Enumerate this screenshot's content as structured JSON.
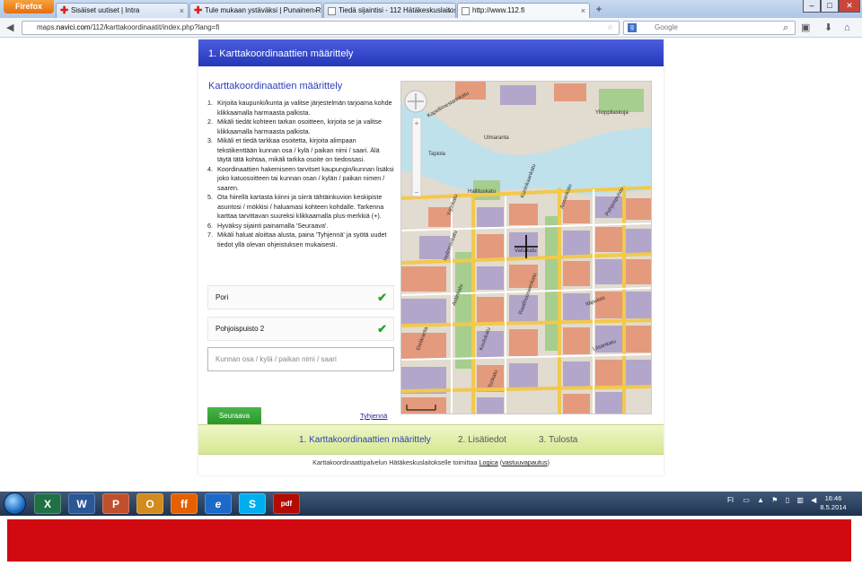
{
  "browser": {
    "menu_button": "Firefox",
    "tabs": [
      {
        "label": "Sisäiset uutiset | Intra",
        "icon": "red-cross-icon"
      },
      {
        "label": "Tule mukaan ystäväksi | Punainen Risti",
        "icon": "red-cross-icon"
      },
      {
        "label": "Tiedä sijaintisi - 112 Hätäkeskuslaitos",
        "icon": "page-icon"
      },
      {
        "label": "http://www.112.fi",
        "icon": "page-icon"
      }
    ],
    "new_tab": "+",
    "url_prefix": "maps.",
    "url_domain": "navici.com",
    "url_path": "/112/karttakoordinaatit/index.php?lang=fi",
    "search_placeholder": "Google",
    "window_buttons": [
      "–",
      "□",
      "✕"
    ]
  },
  "page": {
    "header": "1. Karttakoordinaattien määrittely",
    "heading": "Karttakoordinaattien määrittely",
    "steps": [
      {
        "num": "1.",
        "text": "Kirjoita kaupunki/kunta ja valitse järjestelmän tarjoama kohde klikkaamalla harmaasta palkista."
      },
      {
        "num": "2.",
        "text": "Mikäli tiedät kohteen tarkan osoitteen, kirjoita se ja valitse klikkaamalla harmaasta palkista."
      },
      {
        "num": "3.",
        "text": "Mikäli et tiedä tarkkaa osoitetta, kirjoita alimpaan tekstikenttään kunnan osa / kylä / paikan nimi / saari. Älä täytä tätä kohtaa, mikäli tarkka osoite on tiedossasi."
      },
      {
        "num": "4.",
        "text": "Koordinaattien hakemiseen tarvitset kaupungin/kunnan lisäksi joko katuosoitteen tai kunnan osan / kylän / paikan nimen / saaren."
      },
      {
        "num": "5.",
        "text": "Ota hiirellä kartasta kiinni ja siirrä tähtäinkuvion keskipiste asuntosi / mökkisi / haluamasi kohteen kohdalle. Tarkenna karttaa tarvittavan suureksi klikkaamalla plus-merkkiä (+)."
      },
      {
        "num": "6.",
        "text": "Hyväksy sijainti painamalla 'Seuraava'."
      },
      {
        "num": "7.",
        "text": "Mikäli haluat aloittaa alusta, paina 'Tyhjennä' ja syötä uudet tiedot yllä olevan ohjeistuksen mukaisesti."
      }
    ],
    "field_city": "Pori",
    "field_address": "Pohjoispuisto 2",
    "field_area_placeholder": "Kunnan osa / kylä / paikan nimi / saari",
    "next_button": "Seuraava",
    "clear_link": "Tyhjennä",
    "progress_steps": [
      "1. Karttakoordinaattien määrittely",
      "2. Lisätiedot",
      "3. Tulosta"
    ],
    "footer_text": "Karttakoordinaattipalvelun Hätäkeskuslaitokselle toimittaa",
    "footer_link": "Logica",
    "footer_paren_link": "vastuuvapautus"
  },
  "map": {
    "labels": [
      "Ulmaranta",
      "Kapellimestarinkatu",
      "Yrjönkatu",
      "Pohjoispuisto",
      "Valtakatu",
      "Hallituskatu",
      "Itäpuisto",
      "Isolinnankatu",
      "Raatihuoneenkatu",
      "Eteläranta",
      "Koulukatu",
      "Annankatu",
      "Antinkatu",
      "Torikatu",
      "Liisankatu",
      "Tapiola",
      "Kuninkaankatu",
      "Ylioppilaskuja"
    ],
    "water_color": "#bfe1ec",
    "block_colors": [
      "#e49a7d",
      "#b2a6cb",
      "#a6ce8e",
      "#e2dbcf"
    ]
  },
  "taskbar": {
    "apps": [
      "X",
      "W",
      "P",
      "O",
      "ff",
      "e",
      "S",
      "pdf"
    ],
    "tray_lang": "FI",
    "time": "16:46",
    "date": "8.5.2014"
  },
  "colors": {
    "header_blue": "#2c3fb8",
    "button_green": "#2b962b",
    "bottom_red": "#d10a11"
  }
}
